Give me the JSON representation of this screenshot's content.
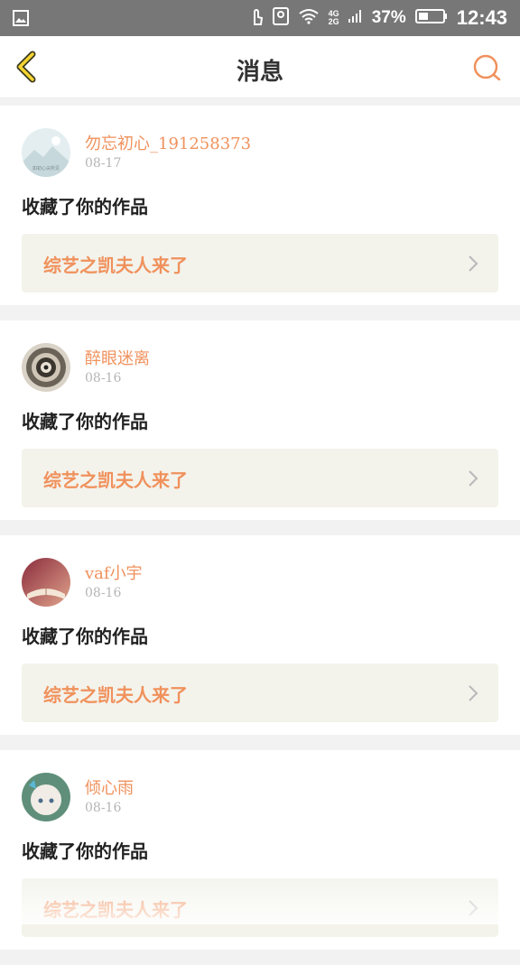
{
  "status_bar": {
    "battery": "37%",
    "time": "12:43",
    "net_top": "4G",
    "net_bottom": "2G",
    "icons": [
      "image-icon",
      "touch-icon",
      "portrait-icon",
      "wifi-icon",
      "signal-icon",
      "battery-icon"
    ]
  },
  "header": {
    "title": "消息",
    "back_icon": "chevron-left-icon",
    "search_icon": "search-icon",
    "accent": "#f0915c"
  },
  "messages": [
    {
      "username": "勿忘初心_191258373",
      "date": "08-17",
      "action": "收藏了你的作品",
      "work_title": "综艺之凯夫人来了",
      "avatar_label": "如初心尖所见"
    },
    {
      "username": "醉眼迷离",
      "date": "08-16",
      "action": "收藏了你的作品",
      "work_title": "综艺之凯夫人来了"
    },
    {
      "username": "vaf小宇",
      "date": "08-16",
      "action": "收藏了你的作品",
      "work_title": "综艺之凯夫人来了"
    },
    {
      "username": "倾心雨",
      "date": "08-16",
      "action": "收藏了你的作品",
      "work_title": "综艺之凯夫人来了"
    }
  ]
}
